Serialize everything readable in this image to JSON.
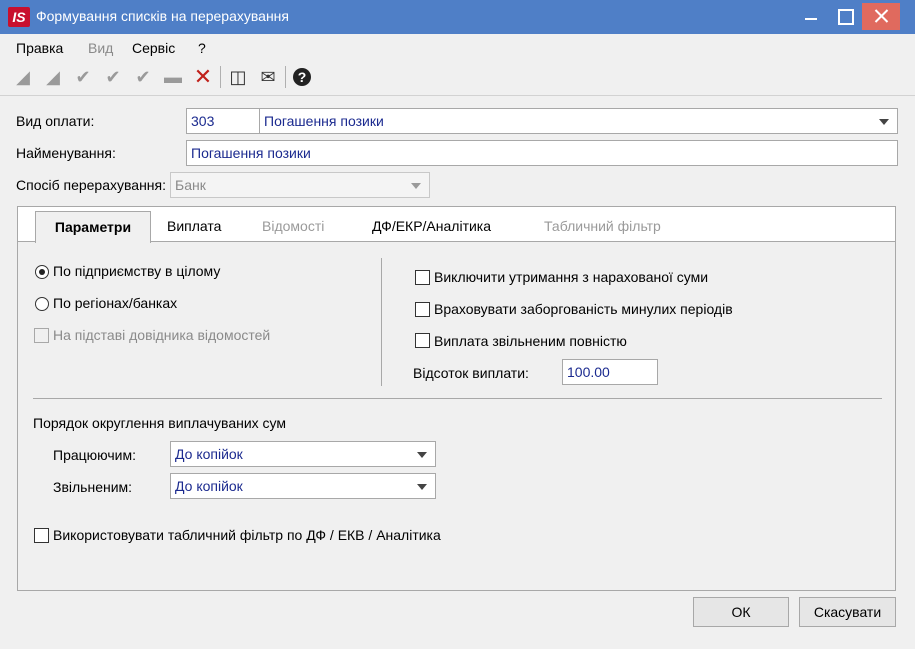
{
  "window": {
    "title": "Формування списків на перерахування",
    "app_icon_text": "IS"
  },
  "menu": [
    "Правка",
    "Вид",
    "Сервіс",
    "?"
  ],
  "form": {
    "payment_type": {
      "label": "Вид оплати:",
      "code": "303",
      "name": "Погашення позики"
    },
    "name": {
      "label": "Найменування:",
      "value": "Погашення позики"
    },
    "transfer_method": {
      "label": "Спосіб перерахування:",
      "value": "Банк"
    }
  },
  "tabs": [
    "Параметри",
    "Виплата",
    "Відомості",
    "ДФ/ЕКР/Аналітика",
    "Табличний фільтр"
  ],
  "params": {
    "radio_enterprise": "По підприємству в цілому",
    "radio_regions": "По регіонах/банках",
    "check_directory": "На підставі довідника відомостей",
    "check_exclude": "Виключити утримання з нарахованої суми",
    "check_debt": "Враховувати заборгованість минулих періодів",
    "check_dismissed": "Виплата звільненим повністю",
    "percent_label": "Відсоток виплати:",
    "percent_value": "100.00",
    "rounding_title": "Порядок округлення виплачуваних сум",
    "working_label": "Працюючим:",
    "working_value": "До копійок",
    "dismissed_label": "Звільненим:",
    "dismissed_value": "До копійок",
    "use_filter": "Використовувати табличний фільтр по ДФ / ЕКВ / Аналітика"
  },
  "buttons": {
    "ok": "ОК",
    "cancel": "Скасувати"
  },
  "colors": {
    "titlebar": "#4f7fc7",
    "close": "#e06a5e",
    "field_text": "#1b2a8f"
  }
}
